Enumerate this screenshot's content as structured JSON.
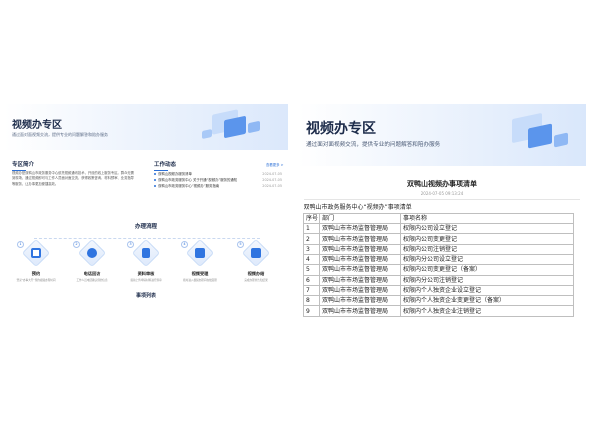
{
  "left_panel": {
    "banner": {
      "title": "视频办专区",
      "subtitle": "通过面对面视频交流，提供专业的问题解答和陪办服务"
    },
    "intro": {
      "heading": "专区简介",
      "text": "视频办是双鸭山市政务服务中心依托视频通讯技术，开设的线上服务专区。群众无需到现场，通过视频即可与工作人员面对面交流，获得政策咨询、材料预审、业务指导等服务，让办事更加便捷高效。"
    },
    "news": {
      "heading": "工作动态",
      "more": "查看更多 >",
      "items": [
        {
          "title": "双鸭山视频办服务清单",
          "date": "2024-07-05"
        },
        {
          "title": "双鸭山市政务服务中心 关于开通“视频办”服务的通知",
          "date": "2024-07-05"
        },
        {
          "title": "双鸭山市政务服务中心“视频办”服务指南",
          "date": "2024-07-05"
        }
      ]
    },
    "process": {
      "heading": "办理流程",
      "steps": [
        {
          "num": "1",
          "label": "预约",
          "desc": "登录“办事大厅”预约视频办理时间"
        },
        {
          "num": "2",
          "label": "电话回访",
          "desc": "工作人员电话确认预约信息"
        },
        {
          "num": "3",
          "label": "资料审核",
          "desc": "提前上传申请材料进行预审"
        },
        {
          "num": "4",
          "label": "视频受理",
          "desc": "按时进入视频办理间在线受理"
        },
        {
          "num": "5",
          "label": "视频办结",
          "desc": "完成办理并告知结果"
        }
      ]
    },
    "list_heading": "事项列表"
  },
  "right_panel": {
    "banner": {
      "title": "视频办专区",
      "subtitle": "通过面对面视频交流，提供专业的问题解答和陪办服务"
    },
    "document": {
      "title": "双鸭山视频办事项清单",
      "date": "2024-07-05 09:13:24"
    },
    "table": {
      "caption": "双鸭山市政务服务中心“视频办”事项清单",
      "headers": [
        "序号",
        "部门",
        "事项名称"
      ],
      "rows": [
        [
          "1",
          "双鸭山市市场监督管理局",
          "权限内公司设立登记"
        ],
        [
          "2",
          "双鸭山市市场监督管理局",
          "权限内公司变更登记"
        ],
        [
          "3",
          "双鸭山市市场监督管理局",
          "权限内公司注销登记"
        ],
        [
          "4",
          "双鸭山市市场监督管理局",
          "权限内分公司设立登记"
        ],
        [
          "5",
          "双鸭山市市场监督管理局",
          "权限内公司变更登记（备案）"
        ],
        [
          "6",
          "双鸭山市市场监督管理局",
          "权限内分公司注销登记"
        ],
        [
          "7",
          "双鸭山市市场监督管理局",
          "权限内个人独资企业设立登记"
        ],
        [
          "8",
          "双鸭山市市场监督管理局",
          "权限内个人独资企业变更登记（备案）"
        ],
        [
          "9",
          "双鸭山市市场监督管理局",
          "权限内个人独资企业注销登记"
        ]
      ]
    }
  },
  "colors": {
    "accent": "#2b6fd6",
    "title": "#1c2b4a",
    "banner_light": "#dbe8fb"
  }
}
